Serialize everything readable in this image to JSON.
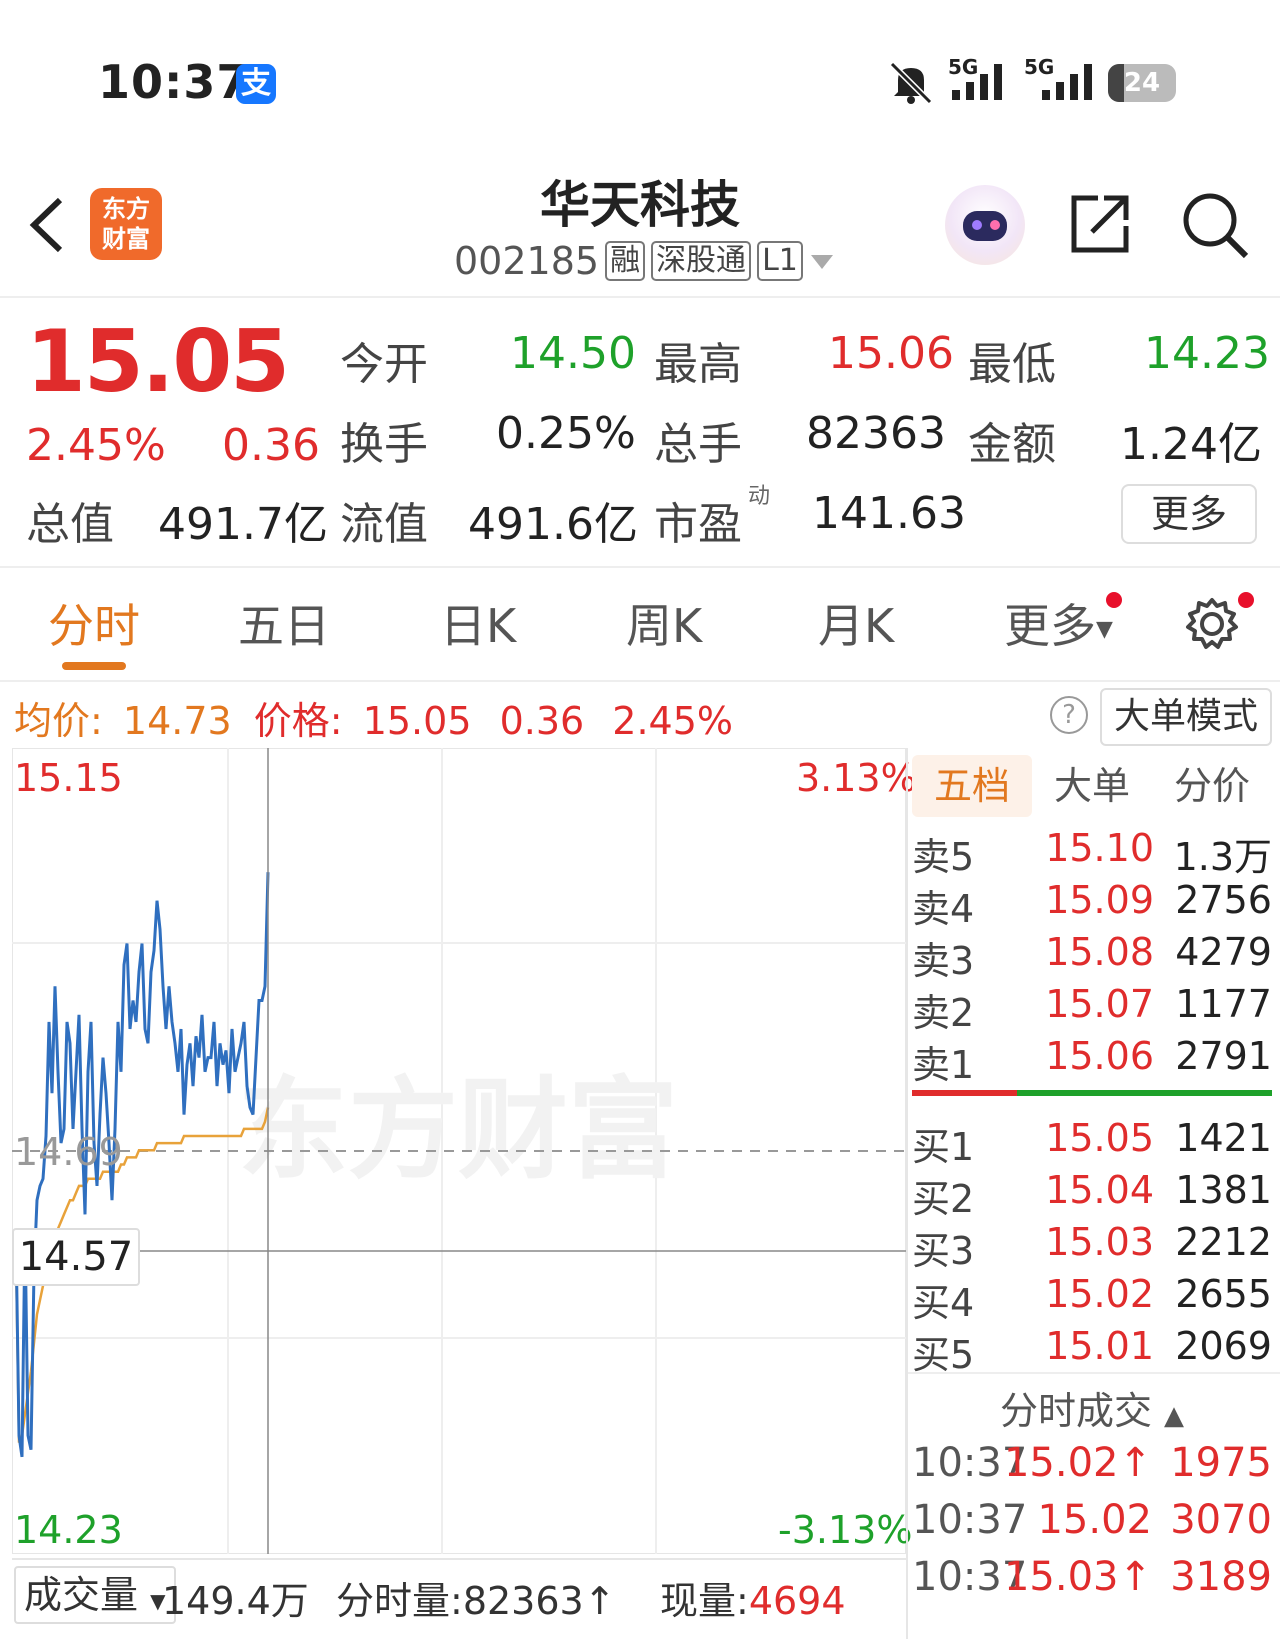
{
  "status_bar": {
    "time": "10:37",
    "battery": "24",
    "network": "5G"
  },
  "header": {
    "app_logo_line1": "东方",
    "app_logo_line2": "财富",
    "stock_name": "华天科技",
    "stock_code": "002185",
    "tags": [
      "融",
      "深股通",
      "L1"
    ]
  },
  "quote": {
    "price": "15.05",
    "change_pct": "2.45%",
    "change": "0.36",
    "open_label": "今开",
    "open": "14.50",
    "high_label": "最高",
    "high": "15.06",
    "low_label": "最低",
    "low": "14.23",
    "turnover_label": "换手",
    "turnover": "0.25%",
    "volume_label": "总手",
    "volume": "82363",
    "amount_label": "金额",
    "amount": "1.24亿",
    "total_mv_label": "总值",
    "total_mv": "491.7亿",
    "float_mv_label": "流值",
    "float_mv": "491.6亿",
    "pe_label": "市盈",
    "pe_sup": "动",
    "pe": "141.63",
    "more_label": "更多"
  },
  "tabs": [
    "分时",
    "五日",
    "日K",
    "周K",
    "月K",
    "更多"
  ],
  "info_row": {
    "avg_label": "均价:",
    "avg": "14.73",
    "price_label": "价格:",
    "price": "15.05",
    "change": "0.36",
    "change_pct": "2.45%",
    "big_order_label": "大单模式"
  },
  "chart_labels": {
    "y_top": "15.15",
    "y_bottom": "14.23",
    "pct_top": "3.13%",
    "pct_bottom": "-3.13%",
    "prev_close": "14.69",
    "crosshair": "14.57",
    "watermark": "东方财富"
  },
  "order_book": {
    "tabs": [
      "五档",
      "大单",
      "分价"
    ],
    "asks": [
      {
        "label": "卖5",
        "price": "15.10",
        "vol": "1.3万"
      },
      {
        "label": "卖4",
        "price": "15.09",
        "vol": "2756"
      },
      {
        "label": "卖3",
        "price": "15.08",
        "vol": "4279"
      },
      {
        "label": "卖2",
        "price": "15.07",
        "vol": "1177"
      },
      {
        "label": "卖1",
        "price": "15.06",
        "vol": "2791"
      }
    ],
    "bids": [
      {
        "label": "买1",
        "price": "15.05",
        "vol": "1421"
      },
      {
        "label": "买2",
        "price": "15.04",
        "vol": "1381"
      },
      {
        "label": "买3",
        "price": "15.03",
        "vol": "2212"
      },
      {
        "label": "买4",
        "price": "15.02",
        "vol": "2655"
      },
      {
        "label": "买5",
        "price": "15.01",
        "vol": "2069"
      }
    ],
    "ticks_title": "分时成交",
    "ticks": [
      {
        "time": "10:37",
        "price": "15.02↑",
        "vol": "1975"
      },
      {
        "time": "10:37",
        "price": "15.02",
        "vol": "3070"
      },
      {
        "time": "10:37",
        "price": "15.03↑",
        "vol": "3189"
      }
    ]
  },
  "volume_row": {
    "selector": "成交量",
    "total": "149.4万",
    "tick_volume_label": "分时量:",
    "tick_volume": "82363↑",
    "current_label": "现量:",
    "current": "4694"
  },
  "colors": {
    "up": "#e02c2c",
    "down": "#1ea12a",
    "accent": "#e2781f",
    "price_line": "#2f6fbf",
    "avg_line": "#e8a23a"
  },
  "chart_data": {
    "type": "line",
    "ylim": [
      14.23,
      15.15
    ],
    "prev_close": 14.69,
    "series": [
      {
        "values": [
          14.55,
          14.27,
          14.24,
          14.56,
          14.27,
          14.25,
          14.5,
          14.6,
          14.62,
          14.63,
          14.69,
          14.85,
          14.75,
          14.9,
          14.78,
          14.68,
          14.7,
          14.85,
          14.82,
          14.7,
          14.78,
          14.86,
          14.7,
          14.58,
          14.78,
          14.85,
          14.68,
          14.62,
          14.72,
          14.8,
          14.75,
          14.68,
          14.6,
          14.7,
          14.85,
          14.78,
          14.93,
          14.96,
          14.84,
          14.88,
          14.85,
          14.92,
          14.96,
          14.84,
          14.82,
          14.92,
          14.95,
          15.02,
          14.98,
          14.9,
          14.84,
          14.9,
          14.85,
          14.82,
          14.78,
          14.84,
          14.72,
          14.79,
          14.82,
          14.76,
          14.83,
          14.8,
          14.86,
          14.78,
          14.8,
          14.8,
          14.85,
          14.76,
          14.82,
          14.79,
          14.81,
          14.75,
          14.84,
          14.78,
          14.8,
          14.82,
          14.85,
          14.76,
          14.73,
          14.72,
          14.8,
          14.88,
          14.88,
          14.9,
          15.06
        ]
      },
      {
        "values": [
          14.52,
          14.26,
          14.27,
          14.3,
          14.33,
          14.36,
          14.4,
          14.44,
          14.46,
          14.48,
          14.5,
          14.52,
          14.54,
          14.55,
          14.56,
          14.57,
          14.58,
          14.59,
          14.6,
          14.6,
          14.61,
          14.62,
          14.62,
          14.62,
          14.63,
          14.63,
          14.63,
          14.63,
          14.63,
          14.64,
          14.64,
          14.64,
          14.64,
          14.64,
          14.64,
          14.65,
          14.65,
          14.66,
          14.66,
          14.66,
          14.66,
          14.67,
          14.67,
          14.67,
          14.67,
          14.67,
          14.67,
          14.68,
          14.68,
          14.68,
          14.68,
          14.68,
          14.68,
          14.68,
          14.68,
          14.68,
          14.69,
          14.69,
          14.69,
          14.69,
          14.69,
          14.69,
          14.69,
          14.69,
          14.69,
          14.69,
          14.69,
          14.69,
          14.69,
          14.69,
          14.69,
          14.69,
          14.69,
          14.69,
          14.69,
          14.69,
          14.7,
          14.7,
          14.7,
          14.7,
          14.7,
          14.7,
          14.7,
          14.71,
          14.73
        ]
      }
    ]
  }
}
